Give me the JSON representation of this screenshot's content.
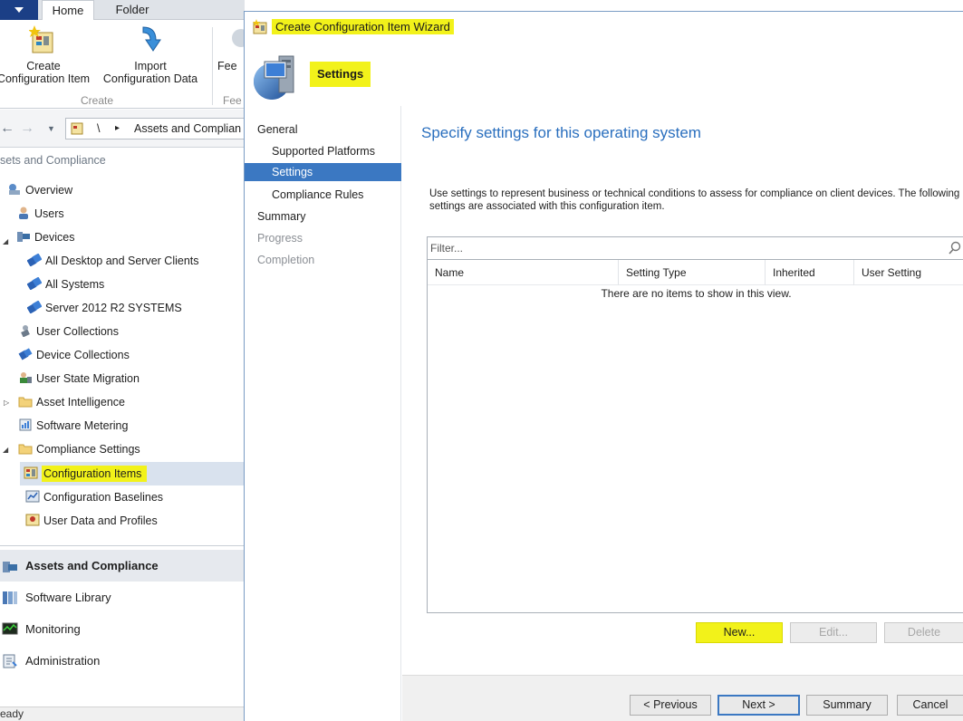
{
  "ribbon": {
    "tabs": [
      {
        "label": "Home",
        "active": true
      },
      {
        "label": "Folder",
        "active": false
      }
    ],
    "buttons": [
      {
        "line1": "Create",
        "line2": "Configuration Item",
        "icon": "create-configuration-item-icon"
      },
      {
        "line1": "Import",
        "line2": "Configuration Data",
        "icon": "import-arrow-icon"
      },
      {
        "line1": "Fee",
        "line2": "",
        "icon": "feedback-icon"
      }
    ],
    "group_label": "Create",
    "group_label_2": "Fee"
  },
  "navbar": {
    "path_separator": "\\",
    "path_chevron": "▸",
    "path_text": "Assets and Complian"
  },
  "workspace_header": "sets and Compliance",
  "tree": [
    {
      "label": "Overview",
      "icon": "overview-icon"
    },
    {
      "label": "Users",
      "icon": "users-icon"
    },
    {
      "label": "Devices",
      "icon": "devices-icon"
    },
    {
      "label": "All Desktop and Server Clients",
      "icon": "collection-icon"
    },
    {
      "label": "All Systems",
      "icon": "collection-icon"
    },
    {
      "label": "Server 2012  R2 SYSTEMS",
      "icon": "collection-icon"
    },
    {
      "label": "User Collections",
      "icon": "user-collections-icon"
    },
    {
      "label": "Device Collections",
      "icon": "device-collections-icon"
    },
    {
      "label": "User State Migration",
      "icon": "user-state-migration-icon"
    },
    {
      "label": "Asset Intelligence",
      "icon": "folder-icon"
    },
    {
      "label": "Software Metering",
      "icon": "software-metering-icon"
    },
    {
      "label": "Compliance Settings",
      "icon": "folder-icon"
    },
    {
      "label": "Configuration Items",
      "icon": "configuration-item-icon"
    },
    {
      "label": "Configuration Baselines",
      "icon": "baseline-icon"
    },
    {
      "label": "User Data and Profiles",
      "icon": "user-data-profiles-icon"
    }
  ],
  "wunderbar": [
    {
      "label": "Assets and Compliance",
      "icon": "assets-compliance-icon",
      "active": true
    },
    {
      "label": "Software Library",
      "icon": "software-library-icon",
      "active": false
    },
    {
      "label": "Monitoring",
      "icon": "monitoring-icon",
      "active": false
    },
    {
      "label": "Administration",
      "icon": "administration-icon",
      "active": false
    }
  ],
  "status_bar": "eady",
  "wizard": {
    "title": "Create Configuration Item Wizard",
    "page_title": "Settings",
    "steps": [
      {
        "label": "General",
        "level": 0,
        "state": "done"
      },
      {
        "label": "Supported Platforms",
        "level": 1,
        "state": "done"
      },
      {
        "label": "Settings",
        "level": 1,
        "state": "current"
      },
      {
        "label": "Compliance Rules",
        "level": 1,
        "state": "pending"
      },
      {
        "label": "Summary",
        "level": 0,
        "state": "pending"
      },
      {
        "label": "Progress",
        "level": 0,
        "state": "disabled"
      },
      {
        "label": "Completion",
        "level": 0,
        "state": "disabled"
      }
    ],
    "heading": "Specify settings for this operating system",
    "description": "Use settings to represent business or technical conditions to assess for compliance on client devices. The following settings are associated with this configuration item.",
    "filter_placeholder": "Filter...",
    "columns": [
      "Name",
      "Setting Type",
      "Inherited",
      "User Setting"
    ],
    "empty_message": "There are no items to show in this view.",
    "list_buttons": {
      "new": "New...",
      "edit": "Edit...",
      "delete": "Delete"
    },
    "nav_buttons": {
      "previous": "< Previous",
      "next": "Next >",
      "summary": "Summary",
      "cancel": "Cancel"
    }
  },
  "colors": {
    "accent": "#3b78c2",
    "heading": "#2a6fbe",
    "highlight": "#f2f21a",
    "app_menu": "#1b3f86"
  }
}
